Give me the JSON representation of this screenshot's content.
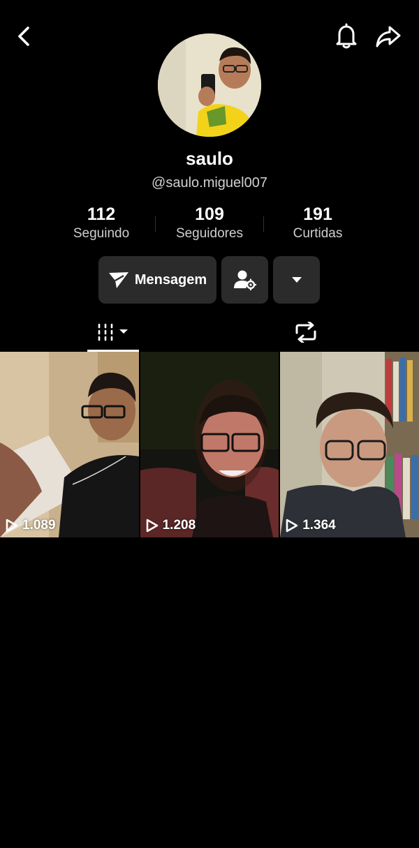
{
  "profile": {
    "name": "saulo",
    "handle": "@saulo.miguel007"
  },
  "stats": [
    {
      "value": "112",
      "label": "Seguindo"
    },
    {
      "value": "109",
      "label": "Seguidores"
    },
    {
      "value": "191",
      "label": "Curtidas"
    }
  ],
  "actions": {
    "message_label": "Mensagem"
  },
  "videos": [
    {
      "views": "1.089"
    },
    {
      "views": "1.208"
    },
    {
      "views": "1.364"
    }
  ],
  "icons": {
    "back": "chevron-left-icon",
    "notifications": "bell-icon",
    "share": "share-icon",
    "message": "send-icon",
    "friend_settings": "user-gear-icon",
    "more": "caret-down-icon",
    "videos_tab": "grid-icon",
    "reposts_tab": "repost-icon",
    "play": "play-icon"
  }
}
